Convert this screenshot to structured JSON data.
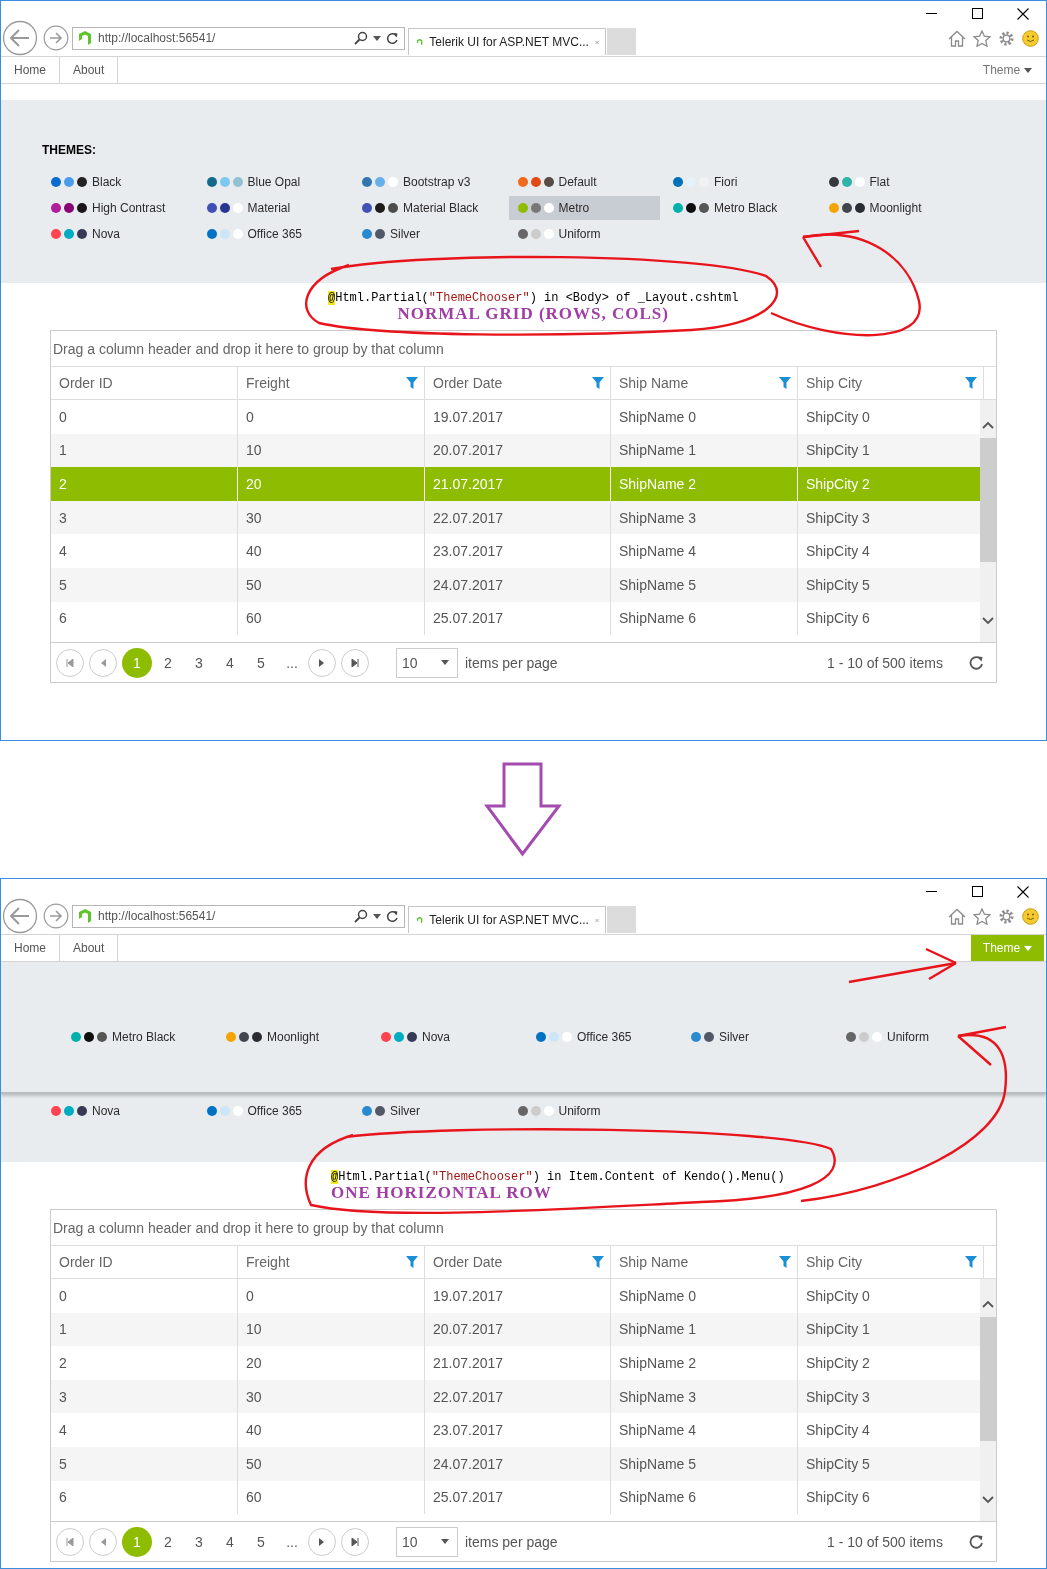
{
  "panels": [
    {
      "browser": {
        "url": "http://localhost:56541/",
        "tab_title": "Telerik UI for ASP.NET MVC..."
      },
      "menu": {
        "items": [
          {
            "label": "Home"
          },
          {
            "label": "About"
          }
        ],
        "theme_button": {
          "label": "Theme",
          "selected": false
        }
      },
      "theme_chooser": {
        "heading": "THEMES:",
        "themes": [
          {
            "name": "Black",
            "dots": [
              {
                "color": "#0a6bd0"
              },
              {
                "color": "#4c9be8"
              },
              {
                "color": "#222222"
              }
            ],
            "selected": false
          },
          {
            "name": "Blue Opal",
            "dots": [
              {
                "color": "#0f6a8b"
              },
              {
                "color": "#7dc8f0"
              },
              {
                "color": "#94c0d2"
              }
            ],
            "selected": false
          },
          {
            "name": "Bootstrap v3",
            "dots": [
              {
                "color": "#3276b1"
              },
              {
                "color": "#67afe9"
              },
              {
                "color": "#ffffff"
              }
            ],
            "selected": false
          },
          {
            "name": "Default",
            "dots": [
              {
                "color": "#f06a1d"
              },
              {
                "color": "#e24a15"
              },
              {
                "color": "#5a4c44"
              }
            ],
            "selected": false
          },
          {
            "name": "Fiori",
            "dots": [
              {
                "color": "#0070b8"
              },
              {
                "color": "#e6f2f9"
              },
              {
                "color": "#f2f2f2"
              }
            ],
            "selected": false
          },
          {
            "name": "Flat",
            "dots": [
              {
                "color": "#363940"
              },
              {
                "color": "#2eb3a6"
              },
              {
                "color": "#ffffff"
              }
            ],
            "selected": false
          },
          {
            "name": "High Contrast",
            "dots": [
              {
                "color": "#b11e9c"
              },
              {
                "color": "#880275"
              },
              {
                "color": "#1b141a"
              }
            ],
            "selected": false
          },
          {
            "name": "Material",
            "dots": [
              {
                "color": "#3f51b5"
              },
              {
                "color": "#283593"
              },
              {
                "color": "#ffffff"
              }
            ],
            "selected": false
          },
          {
            "name": "Material Black",
            "dots": [
              {
                "color": "#3f51b5"
              },
              {
                "color": "#1c1c1c"
              },
              {
                "color": "#4d4d4d"
              }
            ],
            "selected": false
          },
          {
            "name": "Metro",
            "dots": [
              {
                "color": "#8ebc00"
              },
              {
                "color": "#787878"
              },
              {
                "color": "#ffffff"
              }
            ],
            "selected": true
          },
          {
            "name": "Metro Black",
            "dots": [
              {
                "color": "#00b0ab"
              },
              {
                "color": "#0e0e0e"
              },
              {
                "color": "#565656"
              }
            ],
            "selected": false
          },
          {
            "name": "Moonlight",
            "dots": [
              {
                "color": "#f4a503"
              },
              {
                "color": "#424550"
              },
              {
                "color": "#2a2c33"
              }
            ],
            "selected": false
          },
          {
            "name": "Nova",
            "dots": [
              {
                "color": "#ff4350"
              },
              {
                "color": "#00acc1"
              },
              {
                "color": "#363a56"
              }
            ],
            "selected": false
          },
          {
            "name": "Office 365",
            "dots": [
              {
                "color": "#0072c6"
              },
              {
                "color": "#cde6f7"
              },
              {
                "color": "#ffffff"
              }
            ],
            "selected": false
          },
          {
            "name": "Silver",
            "dots": [
              {
                "color": "#298bcd"
              },
              {
                "color": "#515967"
              }
            ],
            "selected": false
          },
          {
            "name": "Uniform",
            "dots": [
              {
                "color": "#666666"
              },
              {
                "color": "#cccccc"
              },
              {
                "color": "#ffffff"
              }
            ],
            "selected": false
          }
        ]
      },
      "annotation": {
        "code_parts": [
          {
            "text": "@",
            "kind": "highlight"
          },
          {
            "text": "Html.Partial(",
            "kind": "plain"
          },
          {
            "text": "\"ThemeChooser\"",
            "kind": "string"
          },
          {
            "text": ") in <Body> of _Layout.cshtml",
            "kind": "plain"
          }
        ],
        "caption": "NORMAL GRID (ROWS, COLS)"
      },
      "grid": {
        "group_hint": "Drag a column header and drop it here to group by that column",
        "columns": [
          {
            "title": "Order ID",
            "filter": false
          },
          {
            "title": "Freight",
            "filter": true
          },
          {
            "title": "Order Date",
            "filter": true
          },
          {
            "title": "Ship Name",
            "filter": true
          },
          {
            "title": "Ship City",
            "filter": true
          }
        ],
        "rows": [
          {
            "cells": [
              "0",
              "0",
              "19.07.2017",
              "ShipName 0",
              "ShipCity 0"
            ],
            "selected": false
          },
          {
            "cells": [
              "1",
              "10",
              "20.07.2017",
              "ShipName 1",
              "ShipCity 1"
            ],
            "selected": false
          },
          {
            "cells": [
              "2",
              "20",
              "21.07.2017",
              "ShipName 2",
              "ShipCity 2"
            ],
            "selected": true
          },
          {
            "cells": [
              "3",
              "30",
              "22.07.2017",
              "ShipName 3",
              "ShipCity 3"
            ],
            "selected": false
          },
          {
            "cells": [
              "4",
              "40",
              "23.07.2017",
              "ShipName 4",
              "ShipCity 4"
            ],
            "selected": false
          },
          {
            "cells": [
              "5",
              "50",
              "24.07.2017",
              "ShipName 5",
              "ShipCity 5"
            ],
            "selected": false
          },
          {
            "cells": [
              "6",
              "60",
              "25.07.2017",
              "ShipName 6",
              "ShipCity 6"
            ],
            "selected": false
          }
        ],
        "pager": {
          "pages": [
            {
              "label": "1",
              "selected": true
            },
            {
              "label": "2",
              "selected": false
            },
            {
              "label": "3",
              "selected": false
            },
            {
              "label": "4",
              "selected": false
            },
            {
              "label": "5",
              "selected": false
            },
            {
              "label": "...",
              "selected": false
            }
          ],
          "page_size": "10",
          "page_size_label": "items per page",
          "info": "1 - 10 of 500 items"
        }
      }
    },
    {
      "browser": {
        "url": "http://localhost:56541/",
        "tab_title": "Telerik UI for ASP.NET MVC..."
      },
      "menu": {
        "items": [
          {
            "label": "Home"
          },
          {
            "label": "About"
          }
        ],
        "theme_button": {
          "label": "Theme",
          "selected": true
        }
      },
      "dropdown_themes": [
        {
          "name": "Metro Black",
          "dots": [
            {
              "color": "#00b0ab"
            },
            {
              "color": "#0e0e0e"
            },
            {
              "color": "#565656"
            }
          ]
        },
        {
          "name": "Moonlight",
          "dots": [
            {
              "color": "#f4a503"
            },
            {
              "color": "#424550"
            },
            {
              "color": "#2a2c33"
            }
          ]
        },
        {
          "name": "Nova",
          "dots": [
            {
              "color": "#ff4350"
            },
            {
              "color": "#00acc1"
            },
            {
              "color": "#363a56"
            }
          ]
        },
        {
          "name": "Office 365",
          "dots": [
            {
              "color": "#0072c6"
            },
            {
              "color": "#cde6f7"
            },
            {
              "color": "#ffffff"
            }
          ]
        },
        {
          "name": "Silver",
          "dots": [
            {
              "color": "#298bcd"
            },
            {
              "color": "#515967"
            }
          ]
        },
        {
          "name": "Uniform",
          "dots": [
            {
              "color": "#666666"
            },
            {
              "color": "#cccccc"
            },
            {
              "color": "#ffffff"
            }
          ]
        }
      ],
      "theme_chooser": {
        "themes": [
          {
            "name": "Nova",
            "dots": [
              {
                "color": "#ff4350"
              },
              {
                "color": "#00acc1"
              },
              {
                "color": "#363a56"
              }
            ],
            "selected": false
          },
          {
            "name": "Office 365",
            "dots": [
              {
                "color": "#0072c6"
              },
              {
                "color": "#cde6f7"
              },
              {
                "color": "#ffffff"
              }
            ],
            "selected": false
          },
          {
            "name": "Silver",
            "dots": [
              {
                "color": "#298bcd"
              },
              {
                "color": "#515967"
              }
            ],
            "selected": false
          },
          {
            "name": "Uniform",
            "dots": [
              {
                "color": "#666666"
              },
              {
                "color": "#cccccc"
              },
              {
                "color": "#ffffff"
              }
            ],
            "selected": false
          }
        ]
      },
      "annotation": {
        "code_parts": [
          {
            "text": "@",
            "kind": "highlight"
          },
          {
            "text": "Html.Partial(",
            "kind": "plain"
          },
          {
            "text": "\"ThemeChooser\"",
            "kind": "string"
          },
          {
            "text": ") in Item.Content of Kendo().Menu()",
            "kind": "plain"
          }
        ],
        "caption": "ONE HORIZONTAL ROW"
      },
      "grid": {
        "group_hint": "Drag a column header and drop it here to group by that column",
        "columns": [
          {
            "title": "Order ID",
            "filter": false
          },
          {
            "title": "Freight",
            "filter": true
          },
          {
            "title": "Order Date",
            "filter": true
          },
          {
            "title": "Ship Name",
            "filter": true
          },
          {
            "title": "Ship City",
            "filter": true
          }
        ],
        "rows": [
          {
            "cells": [
              "0",
              "0",
              "19.07.2017",
              "ShipName 0",
              "ShipCity 0"
            ],
            "selected": false
          },
          {
            "cells": [
              "1",
              "10",
              "20.07.2017",
              "ShipName 1",
              "ShipCity 1"
            ],
            "selected": false
          },
          {
            "cells": [
              "2",
              "20",
              "21.07.2017",
              "ShipName 2",
              "ShipCity 2"
            ],
            "selected": false
          },
          {
            "cells": [
              "3",
              "30",
              "22.07.2017",
              "ShipName 3",
              "ShipCity 3"
            ],
            "selected": false
          },
          {
            "cells": [
              "4",
              "40",
              "23.07.2017",
              "ShipName 4",
              "ShipCity 4"
            ],
            "selected": false
          },
          {
            "cells": [
              "5",
              "50",
              "24.07.2017",
              "ShipName 5",
              "ShipCity 5"
            ],
            "selected": false
          },
          {
            "cells": [
              "6",
              "60",
              "25.07.2017",
              "ShipName 6",
              "ShipCity 6"
            ],
            "selected": false
          }
        ],
        "pager": {
          "pages": [
            {
              "label": "1",
              "selected": true
            },
            {
              "label": "2",
              "selected": false
            },
            {
              "label": "3",
              "selected": false
            },
            {
              "label": "4",
              "selected": false
            },
            {
              "label": "5",
              "selected": false
            },
            {
              "label": "...",
              "selected": false
            }
          ],
          "page_size": "10",
          "page_size_label": "items per page",
          "info": "1 - 10 of 500 items"
        }
      }
    }
  ]
}
